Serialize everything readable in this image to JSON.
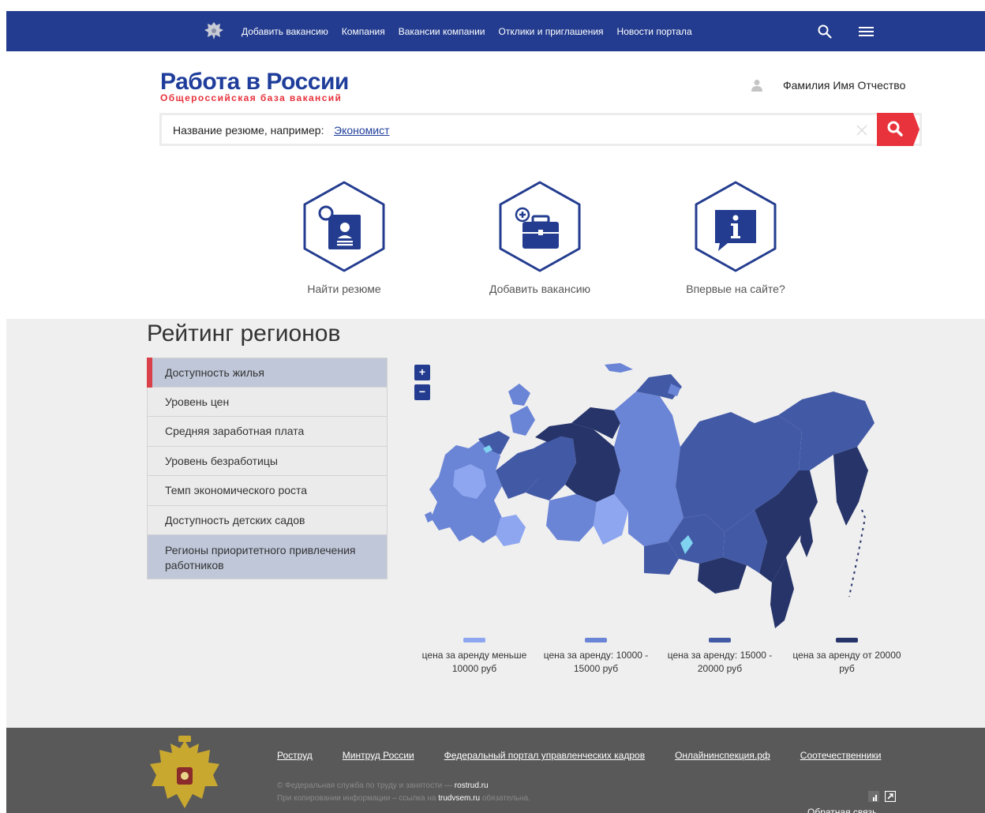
{
  "nav": {
    "items": [
      "Добавить вакансию",
      "Компания",
      "Вакансии компании",
      "Отклики и приглашения",
      "Новости портала"
    ]
  },
  "header": {
    "logo_main": "Работа в России",
    "logo_sub": "Общероссийская база вакансий",
    "user_name": "Фамилия Имя Отчество"
  },
  "search": {
    "hint": "Название резюме, например:",
    "example": "Экономист"
  },
  "tiles": [
    {
      "label": "Найти резюме",
      "icon": "resume-search-icon"
    },
    {
      "label": "Добавить вакансию",
      "icon": "add-briefcase-icon"
    },
    {
      "label": "Впервые на сайте?",
      "icon": "info-icon"
    }
  ],
  "rating": {
    "title": "Рейтинг регионов",
    "tabs": [
      "Доступность жилья",
      "Уровень цен",
      "Средняя заработная плата",
      "Уровень безработицы",
      "Темп экономического роста",
      "Доступность детских садов",
      "Регионы приоритетного привлечения работников"
    ],
    "active_tab": 0,
    "zoom_in": "+",
    "zoom_out": "−",
    "legend": [
      {
        "label": "цена за аренду меньше 10000 руб",
        "color": "#8ea6f0"
      },
      {
        "label": "цена за аренду: 10000 - 15000 руб",
        "color": "#6a84d6"
      },
      {
        "label": "цена за аренду: 15000 - 20000 руб",
        "color": "#4259a6"
      },
      {
        "label": "цена за аренду от 20000 руб",
        "color": "#26346a"
      }
    ]
  },
  "footer": {
    "links": [
      "Роструд",
      "Минтруд России",
      "Федеральный портал управленческих кадров",
      "Онлайнинспекция.рф",
      "Соотечественники"
    ],
    "copy_prefix": "© Федеральная служба по труду и занятости — ",
    "copy_site": "rostrud.ru",
    "copy2_prefix": "При копировании информации – ссылка на ",
    "copy2_site": "trudvsem.ru",
    "copy2_suffix": " обязательна.",
    "feedback": "Обратная связь"
  },
  "colors": {
    "nav_bg": "#233c8f",
    "accent_red": "#e8323c",
    "footer_bg": "#595959"
  }
}
